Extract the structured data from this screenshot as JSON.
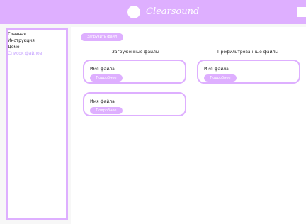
{
  "header": {
    "brand_name": "Clearsound"
  },
  "sidebar": {
    "items": [
      {
        "label": "Главная"
      },
      {
        "label": "Инструкция"
      },
      {
        "label": "Демо"
      },
      {
        "label": "Список файлов"
      }
    ]
  },
  "main": {
    "upload_button": "Загрузить файл",
    "sections": {
      "uploaded_title": "Загруженные файлы",
      "filtered_title": "Профильтрованные файлы"
    },
    "cards": [
      {
        "title": "Имя файла",
        "button": "Подробнее"
      },
      {
        "title": "Имя файла",
        "button": "Подробнее"
      },
      {
        "title": "Имя файла",
        "button": "Подробнее"
      }
    ]
  },
  "colors": {
    "accent": "#deafff",
    "active_nav": "#c4a0ff"
  }
}
